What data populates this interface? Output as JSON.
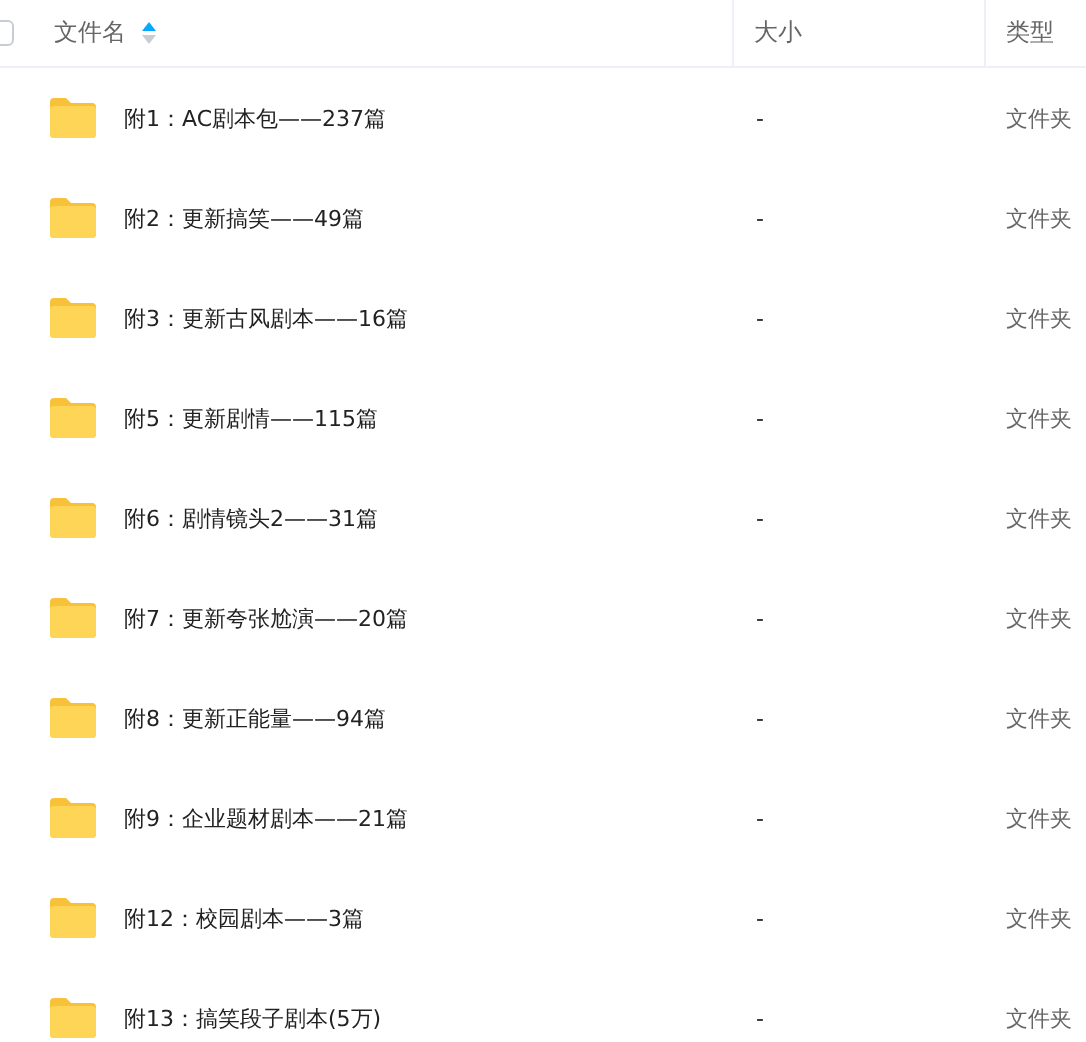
{
  "header": {
    "checked": false,
    "columns": [
      {
        "label": "文件名",
        "sorted_ascending": true
      },
      {
        "label": "大小"
      },
      {
        "label": "类型"
      }
    ]
  },
  "rows": [
    {
      "name": "附1：AC剧本包——237篇",
      "size": "-",
      "type": "文件夹"
    },
    {
      "name": "附2：更新搞笑——49篇",
      "size": "-",
      "type": "文件夹"
    },
    {
      "name": "附3：更新古风剧本——16篇",
      "size": "-",
      "type": "文件夹"
    },
    {
      "name": "附5：更新剧情——115篇",
      "size": "-",
      "type": "文件夹"
    },
    {
      "name": "附6：剧情镜头2——31篇",
      "size": "-",
      "type": "文件夹"
    },
    {
      "name": "附7：更新夸张尬演——20篇",
      "size": "-",
      "type": "文件夹"
    },
    {
      "name": "附8：更新正能量——94篇",
      "size": "-",
      "type": "文件夹"
    },
    {
      "name": "附9：企业题材剧本——21篇",
      "size": "-",
      "type": "文件夹"
    },
    {
      "name": "附12：校园剧本——3篇",
      "size": "-",
      "type": "文件夹"
    },
    {
      "name": "附13：搞笑段子剧本(5万)",
      "size": "-",
      "type": "文件夹"
    }
  ]
}
